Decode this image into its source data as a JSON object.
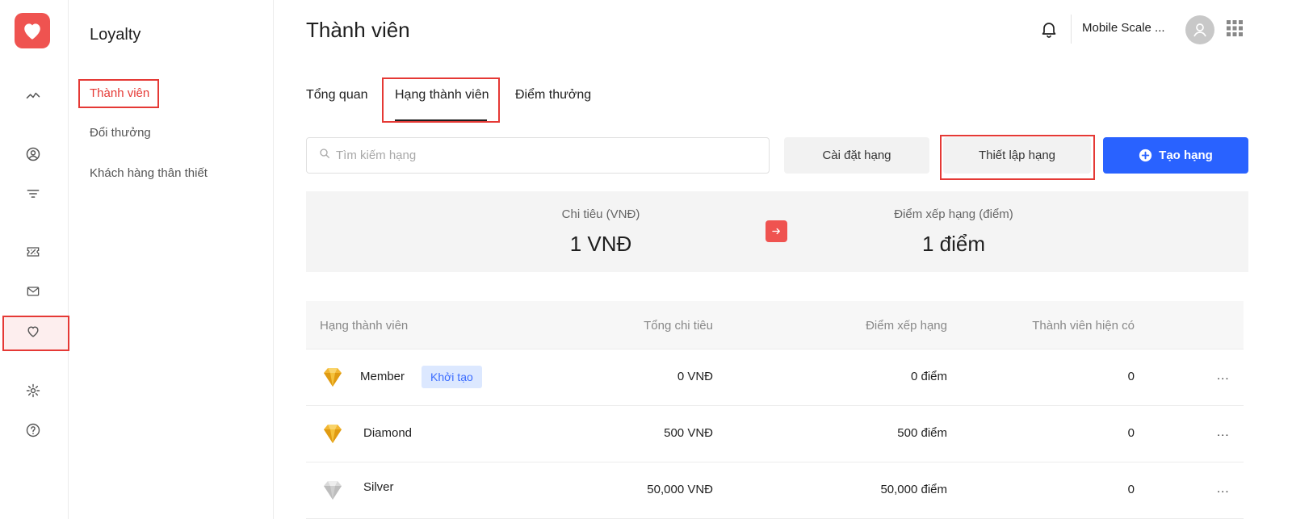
{
  "app": {
    "section_title": "Loyalty",
    "page_title": "Thành viên"
  },
  "sidebar": {
    "items": [
      {
        "label": "Thành viên",
        "active": true
      },
      {
        "label": "Đổi thưởng",
        "active": false
      },
      {
        "label": "Khách hàng thân thiết",
        "active": false
      }
    ]
  },
  "rail": {
    "icons": [
      "chart-line-icon",
      "user-circle-icon",
      "filter-icon",
      "ticket-icon",
      "mail-icon",
      "heart-icon",
      "gear-icon",
      "help-icon"
    ],
    "active_icon": "heart-icon"
  },
  "topbar": {
    "company": "Mobile Scale ...",
    "bell_icon": "bell-icon",
    "apps_icon": "grid-icon"
  },
  "tabs": [
    {
      "label": "Tổng quan",
      "active": false
    },
    {
      "label": "Hạng thành viên",
      "active": true
    },
    {
      "label": "Điểm thưởng",
      "active": false
    }
  ],
  "toolbar": {
    "search_placeholder": "Tìm kiếm hạng",
    "settings_label": "Cài đặt hạng",
    "setup_label": "Thiết lập hạng",
    "create_label": "Tạo hạng"
  },
  "summary": {
    "spend_label": "Chi tiêu (VNĐ)",
    "spend_value": "1 VNĐ",
    "points_label": "Điểm xếp hạng (điểm)",
    "points_value": "1 điểm"
  },
  "table": {
    "headers": [
      "Hạng thành viên",
      "Tổng chi tiêu",
      "Điểm xếp hạng",
      "Thành viên hiện có"
    ],
    "rows": [
      {
        "name": "Member",
        "badge": "Khởi tạo",
        "spend": "0 VNĐ",
        "points": "0 điểm",
        "members": "0",
        "gem": "gold",
        "more": "..."
      },
      {
        "name": "Diamond",
        "badge": "",
        "spend": "500 VNĐ",
        "points": "500 điểm",
        "members": "0",
        "gem": "gold",
        "more": "..."
      },
      {
        "name": "Silver",
        "badge": "",
        "spend": "50,000 VNĐ",
        "points": "50,000 điểm",
        "members": "0",
        "gem": "silver",
        "more": "..."
      }
    ]
  },
  "colors": {
    "brand": "#ef5350",
    "primary": "#2962ff",
    "highlight": "#e53935",
    "badge_bg": "#dce8ff",
    "badge_text": "#3b6cff"
  }
}
